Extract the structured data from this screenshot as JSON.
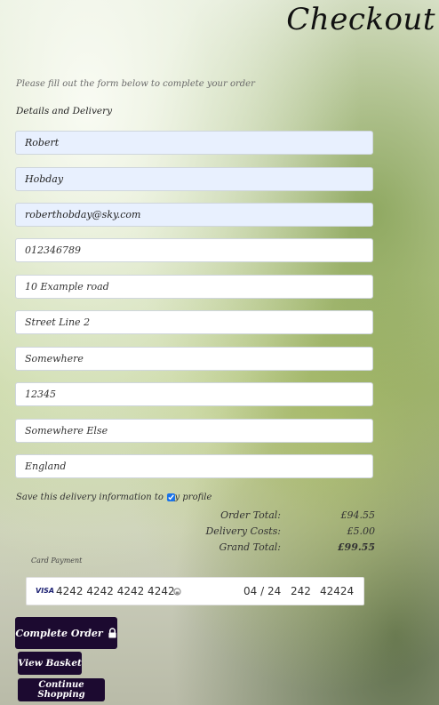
{
  "header": {
    "title": "Checkout"
  },
  "intro_text": "Please fill out the form below to complete your order",
  "section_title": "Details and Delivery",
  "fields": {
    "first_name": "Robert",
    "last_name": "Hobday",
    "email": "roberthobday@sky.com",
    "phone": "012346789",
    "street1": "10 Example road",
    "street2": "Street Line 2",
    "town": "Somewhere",
    "postcode": "12345",
    "county": "Somewhere Else",
    "country": "England"
  },
  "save_info": {
    "label": "Save this delivery information to my profile",
    "checked": true
  },
  "totals": {
    "order_total_label": "Order Total:",
    "order_total": "£94.55",
    "delivery_label": "Delivery Costs:",
    "delivery": "£5.00",
    "grand_total_label": "Grand Total:",
    "grand_total": "£99.55"
  },
  "payment": {
    "label": "Card Payment",
    "brand": "VISA",
    "card_number": "4242 4242 4242 4242",
    "expiry": "04 / 24",
    "cvc": "242",
    "postcode": "42424"
  },
  "buttons": {
    "complete_order": "Complete Order",
    "view_basket": "View Basket",
    "continue_shopping": "Continue Shopping"
  },
  "icons": {
    "lock": "lock-icon",
    "cvc": "cvc-icon"
  },
  "colors": {
    "button_bg": "#1c0a30",
    "autofill_bg": "#e8f0fe"
  }
}
